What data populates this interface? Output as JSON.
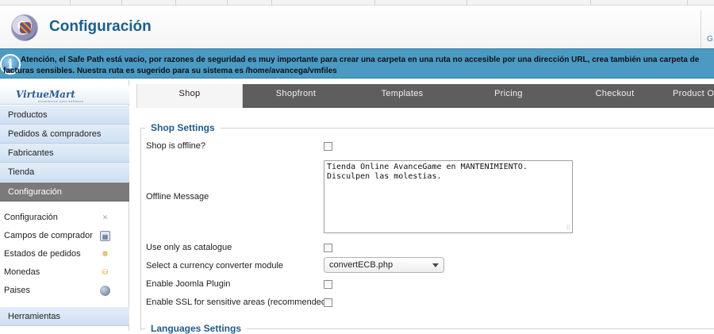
{
  "header": {
    "title": "Configuración",
    "right_fragment": "G"
  },
  "notice": {
    "text": "Atención, el Safe Path está vacio, por razones de seguridad es muy importante para crear una carpeta en una ruta no accesible por una dirección URL, crea también una carpeta de facturas sensibles. Nuestra ruta es sugerido para su sistema es /home/avancega/vmfiles"
  },
  "sidebar": {
    "logo_text": "VirtueMart",
    "logo_tagline": "ecommerce your software",
    "menu": [
      {
        "label": "Productos"
      },
      {
        "label": "Pedidos & compradores"
      },
      {
        "label": "Fabricantes"
      },
      {
        "label": "Tienda"
      },
      {
        "label": "Configuración",
        "active": true
      }
    ],
    "submenu": [
      {
        "label": "Configuración",
        "icon": "tools-icon"
      },
      {
        "label": "Campos de comprador",
        "icon": "users-icon"
      },
      {
        "label": "Estados de pedidos",
        "icon": "status-icon"
      },
      {
        "label": "Monedas",
        "icon": "coins-icon"
      },
      {
        "label": "Paises",
        "icon": "globe-icon"
      }
    ],
    "bottom_menu": [
      {
        "label": "Herramientas"
      }
    ]
  },
  "tabs": [
    {
      "label": "Shop",
      "active": true
    },
    {
      "label": "Shopfront"
    },
    {
      "label": "Templates"
    },
    {
      "label": "Pricing"
    },
    {
      "label": "Checkout"
    },
    {
      "label": "Product O"
    }
  ],
  "shop_settings": {
    "legend": "Shop Settings",
    "offline_label": "Shop is offline?",
    "offline_checked": false,
    "offline_message_label": "Offline Message",
    "offline_message_value": "Tienda Online AvanceGame en MANTENIMIENTO.\nDisculpen las molestias.",
    "catalogue_label": "Use only as catalogue",
    "catalogue_checked": false,
    "currency_label": "Select a currency converter module",
    "currency_value": "convertECB.php",
    "joomla_label": "Enable Joomla Plugin",
    "joomla_checked": false,
    "ssl_label": "Enable SSL for sensitive areas (recommended)",
    "ssl_checked": false
  },
  "languages_settings": {
    "legend": "Languages Settings"
  },
  "colors": {
    "header_title": "#1b5f8e",
    "notice_bg": "#4a9ac4",
    "tab_bar": "#5e5e5e",
    "sidebar_active": "#7a7a7a"
  }
}
